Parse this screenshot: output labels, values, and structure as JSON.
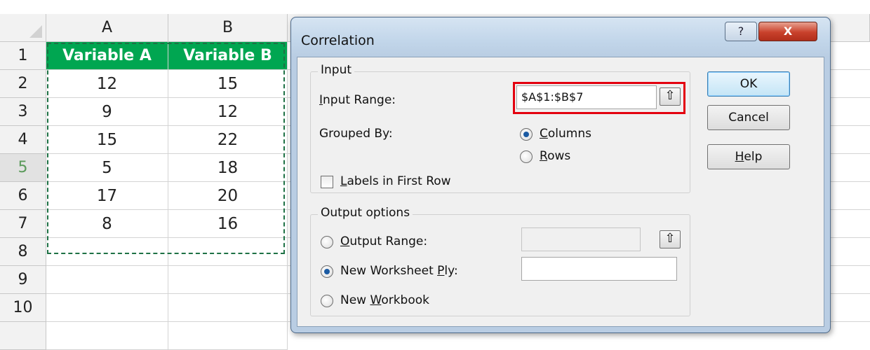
{
  "sheet": {
    "columns": [
      "A",
      "B"
    ],
    "rows": [
      "1",
      "2",
      "3",
      "4",
      "5",
      "6",
      "7",
      "8",
      "9",
      "10"
    ],
    "headers": [
      "Variable A",
      "Variable B"
    ],
    "data": [
      [
        "12",
        "15"
      ],
      [
        "9",
        "12"
      ],
      [
        "15",
        "22"
      ],
      [
        "5",
        "18"
      ],
      [
        "17",
        "20"
      ],
      [
        "8",
        "16"
      ]
    ],
    "header_fill": "#00a651"
  },
  "dialog": {
    "title": "Correlation",
    "help_glyph": "?",
    "close_glyph": "X",
    "input": {
      "group_label": "Input",
      "range_label": "Input Range:",
      "range_value": "$A$1:$B$7",
      "grouped_by_label": "Grouped By:",
      "columns_label": "Columns",
      "rows_label": "Rows",
      "grouped_by_selected": "Columns",
      "labels_first_row": "Labels in First Row",
      "labels_first_row_checked": false
    },
    "output": {
      "group_label": "Output options",
      "output_range_label": "Output Range:",
      "output_range_value": "",
      "new_worksheet_label": "New Worksheet Ply:",
      "new_worksheet_value": "",
      "new_workbook_label": "New Workbook",
      "selected": "New Worksheet Ply"
    },
    "buttons": {
      "ok": "OK",
      "cancel": "Cancel",
      "help": "Help"
    },
    "picker_glyph": "⇧",
    "highlight_color": "#e3000f"
  }
}
